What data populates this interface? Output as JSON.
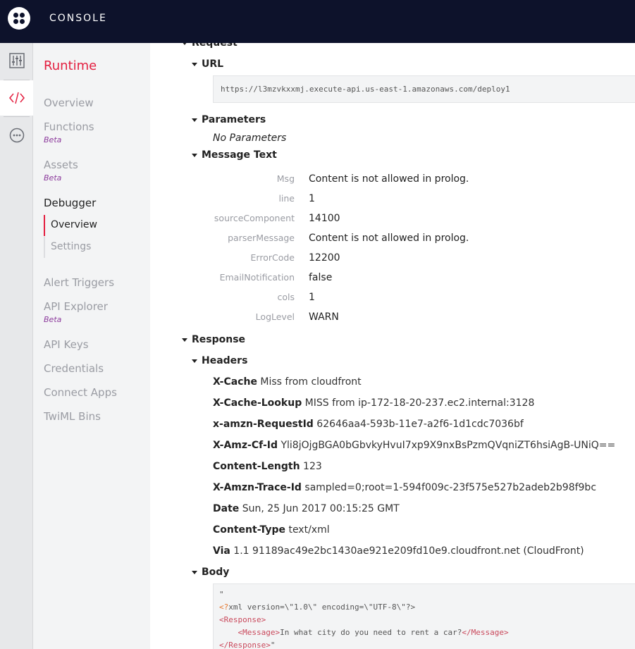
{
  "topbar": {
    "title": "CONSOLE"
  },
  "sidebar": {
    "title": "Runtime",
    "items": {
      "overview": "Overview",
      "functions": "Functions",
      "functions_badge": "Beta",
      "assets": "Assets",
      "assets_badge": "Beta",
      "debugger": "Debugger",
      "debugger_overview": "Overview",
      "debugger_settings": "Settings",
      "alert_triggers": "Alert Triggers",
      "api_explorer": "API Explorer",
      "api_explorer_badge": "Beta",
      "api_keys": "API Keys",
      "credentials": "Credentials",
      "connect_apps": "Connect Apps",
      "twiml_bins": "TwiML Bins"
    }
  },
  "request": {
    "label": "Request",
    "url_label": "URL",
    "url": "https://l3mzvkxxmj.execute-api.us-east-1.amazonaws.com/deploy1",
    "parameters_label": "Parameters",
    "no_parameters": "No Parameters",
    "message_text_label": "Message Text",
    "message_text": [
      {
        "key": "Msg",
        "value": "Content is not allowed in prolog."
      },
      {
        "key": "line",
        "value": "1"
      },
      {
        "key": "sourceComponent",
        "value": "14100"
      },
      {
        "key": "parserMessage",
        "value": "Content is not allowed in prolog."
      },
      {
        "key": "ErrorCode",
        "value": "12200"
      },
      {
        "key": "EmailNotification",
        "value": "false"
      },
      {
        "key": "cols",
        "value": "1"
      },
      {
        "key": "LogLevel",
        "value": "WARN"
      }
    ]
  },
  "response": {
    "label": "Response",
    "headers_label": "Headers",
    "headers": [
      {
        "name": "X-Cache",
        "value": "Miss from cloudfront"
      },
      {
        "name": "X-Cache-Lookup",
        "value": "MISS from ip-172-18-20-237.ec2.internal:3128"
      },
      {
        "name": "x-amzn-RequestId",
        "value": "62646aa4-593b-11e7-a2f6-1d1cdc7036bf"
      },
      {
        "name": "X-Amz-Cf-Id",
        "value": "Yli8jOjgBGA0bGbvkyHvuI7xp9X9nxBsPzmQVqniZT6hsiAgB-UNiQ=="
      },
      {
        "name": "Content-Length",
        "value": "123"
      },
      {
        "name": "X-Amzn-Trace-Id",
        "value": "sampled=0;root=1-594f009c-23f575e527b2adeb2b98f9bc"
      },
      {
        "name": "Date",
        "value": "Sun, 25 Jun 2017 00:15:25 GMT"
      },
      {
        "name": "Content-Type",
        "value": "text/xml"
      },
      {
        "name": "Via",
        "value": "1.1 91189ac49e2bc1430ae921e209fd10e9.cloudfront.net (CloudFront)"
      }
    ],
    "body_label": "Body",
    "body": {
      "line1": "\"",
      "line2_prefix": "<?",
      "line2_rest": "xml version=\\\"1.0\\\" encoding=\\\"UTF-8\\\"?>",
      "line3": "<Response>",
      "line4_open": "<Message>",
      "line4_text": "In what city do you need to rent a car?",
      "line4_close": "</Message>",
      "line5": "</Response>",
      "line5_tail": "\""
    }
  },
  "colors": {
    "accent": "#e31e3f",
    "topbar": "#0d122b",
    "beta": "#8c3a9c"
  }
}
